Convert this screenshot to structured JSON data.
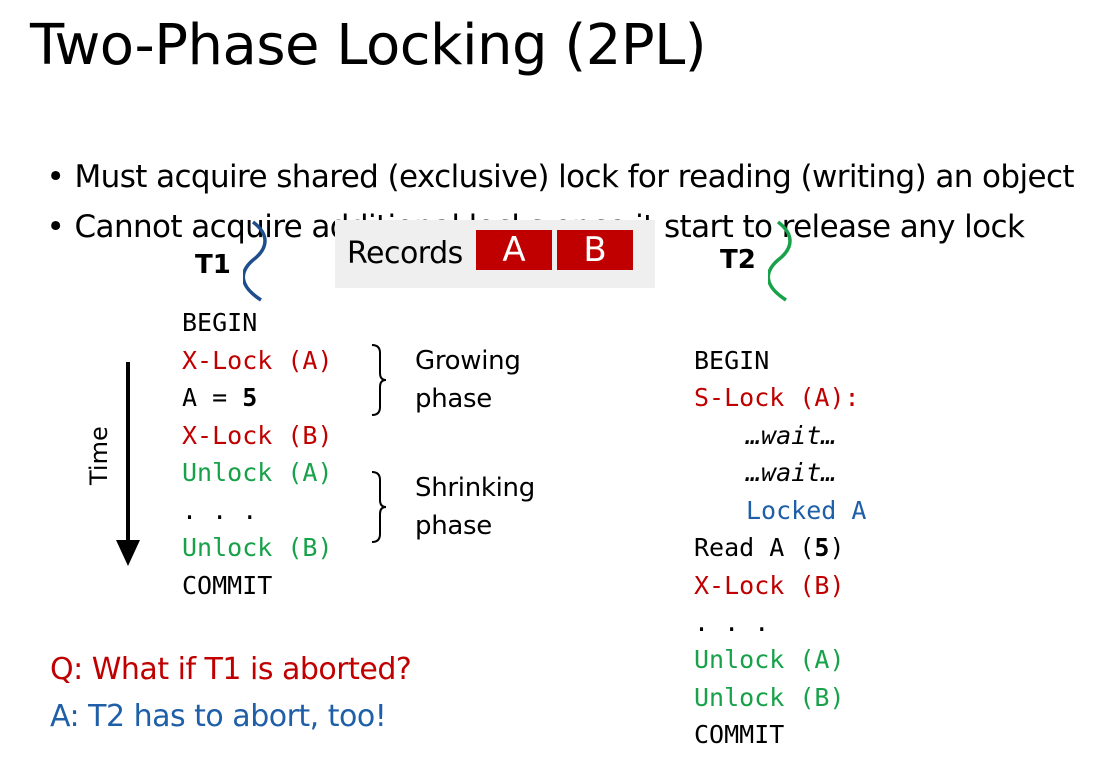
{
  "title": "Two-Phase Locking (2PL)",
  "bullets": [
    "Must acquire shared (exclusive) lock for reading (writing) an object",
    "Cannot acquire additional locks once it start to release any lock"
  ],
  "records": {
    "label": "Records",
    "cells": [
      "A",
      "B"
    ]
  },
  "t1": {
    "label": "T1",
    "lines": {
      "begin": "BEGIN",
      "xlock_a": "X-Lock (A)",
      "assign_lhs": "A = ",
      "assign_val": "5",
      "xlock_b": "X-Lock (B)",
      "unlock_a": "Unlock (A)",
      "dots": ". . .",
      "unlock_b": "Unlock (B)",
      "commit": "COMMIT"
    }
  },
  "phases": {
    "growing_1": "Growing",
    "growing_2": "phase",
    "shrinking_1": "Shrinking",
    "shrinking_2": "phase"
  },
  "time_label": "Time",
  "t2": {
    "label": "T2",
    "lines": {
      "begin": "BEGIN",
      "slock_a": "S-Lock (A):",
      "wait1": "…wait…",
      "wait2": "…wait…",
      "locked": "Locked A",
      "read_pre": "Read A (",
      "read_val": "5",
      "read_post": ")",
      "xlock_b": "X-Lock (B)",
      "dots": ". . .",
      "unlock_a": "Unlock (A)",
      "unlock_b": "Unlock (B)",
      "commit": "COMMIT"
    }
  },
  "qa": {
    "question": "Q: What if T1 is aborted?",
    "answer": "A: T2 has to abort, too!"
  },
  "colors": {
    "red": "#c00000",
    "green": "#17a24a",
    "blue": "#1f5fa8",
    "t1_squiggle": "#1f4e8c",
    "t2_squiggle": "#17a24a"
  }
}
